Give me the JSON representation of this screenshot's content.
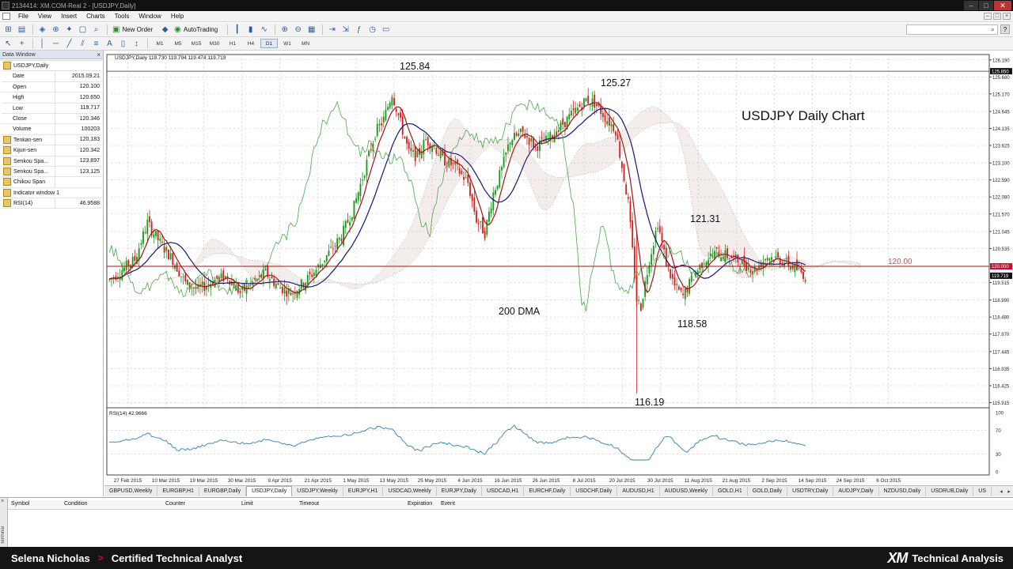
{
  "window": {
    "title": "2134414: XM.COM-Real 2 - [USDJPY,Daily]",
    "minimize": "–",
    "maximize": "□",
    "close": "✕"
  },
  "menu": [
    "File",
    "View",
    "Insert",
    "Charts",
    "Tools",
    "Window",
    "Help"
  ],
  "toolbar": {
    "new_order": "New Order",
    "autotrading": "AutoTrading",
    "timeframes": [
      "M1",
      "M5",
      "M15",
      "M30",
      "H1",
      "H4",
      "D1",
      "W1",
      "MN"
    ],
    "active_timeframe": "D1"
  },
  "data_window": {
    "title": "Data Window",
    "symbol": "USDJPY,Daily",
    "rows": [
      {
        "label": "Date",
        "value": "2015.09.21"
      },
      {
        "label": "Open",
        "value": "120.100"
      },
      {
        "label": "High",
        "value": "120.650"
      },
      {
        "label": "Low",
        "value": "119.717"
      },
      {
        "label": "Close",
        "value": "120.346"
      },
      {
        "label": "Volume",
        "value": "100203"
      }
    ],
    "indicators": [
      {
        "label": "Tenkan-sen",
        "value": "120.183"
      },
      {
        "label": "Kijun-sen",
        "value": "120.342"
      },
      {
        "label": "Senkou Spa...",
        "value": "123.897"
      },
      {
        "label": "Senkou Spa...",
        "value": "123.125"
      },
      {
        "label": "Chikou Span",
        "value": ""
      }
    ],
    "indicator_window": "Indicator window 1",
    "rsi": {
      "label": "RSI(14)",
      "value": "46.9588"
    }
  },
  "chart_data": {
    "type": "candlestick",
    "header": "USDJPY,Daily 119.730 119.794 119.474 119.719",
    "annotation_title": "USDJPY Daily Chart",
    "annotations": [
      "125.84",
      "125.27",
      "121.31",
      "118.58",
      "116.19",
      "200 DMA",
      "120.00"
    ],
    "y_ticks": [
      "126.190",
      "125.680",
      "125.170",
      "124.645",
      "124.135",
      "123.625",
      "123.100",
      "122.590",
      "122.080",
      "121.570",
      "121.045",
      "120.535",
      "119.515",
      "118.990",
      "118.480",
      "117.970",
      "117.445",
      "116.935",
      "116.425",
      "115.915"
    ],
    "price_tags": [
      "125.850",
      "120.000",
      "119.719"
    ],
    "x_ticks": [
      "27 Feb 2015",
      "10 Mar 2015",
      "19 Mar 2015",
      "30 Mar 2015",
      "9 Apr 2015",
      "21 Apr 2015",
      "1 May 2015",
      "13 May 2015",
      "25 May 2015",
      "4 Jun 2015",
      "16 Jun 2015",
      "26 Jun 2015",
      "8 Jul 2015",
      "20 Jul 2015",
      "30 Jul 2015",
      "11 Aug 2015",
      "21 Aug 2015",
      "2 Sep 2015",
      "14 Sep 2015",
      "24 Sep 2015",
      "6 Oct 2015"
    ],
    "ylim": [
      115.76,
      126.35
    ],
    "ohlc_key_points": [
      [
        0,
        119.6
      ],
      [
        6,
        119.9
      ],
      [
        12,
        120.2
      ],
      [
        18,
        121.3
      ],
      [
        24,
        120.7
      ],
      [
        30,
        120.2
      ],
      [
        36,
        119.5
      ],
      [
        42,
        119.3
      ],
      [
        50,
        119.6
      ],
      [
        56,
        119.7
      ],
      [
        62,
        119.2
      ],
      [
        68,
        119.5
      ],
      [
        74,
        119.8
      ],
      [
        80,
        119.4
      ],
      [
        86,
        119.2
      ],
      [
        92,
        119.5
      ],
      [
        98,
        119.9
      ],
      [
        104,
        120.4
      ],
      [
        110,
        120.9
      ],
      [
        116,
        121.8
      ],
      [
        122,
        123.1
      ],
      [
        126,
        124.0
      ],
      [
        130,
        124.4
      ],
      [
        134,
        125.2
      ],
      [
        138,
        124.3
      ],
      [
        142,
        123.4
      ],
      [
        146,
        123.3
      ],
      [
        150,
        123.8
      ],
      [
        154,
        123.6
      ],
      [
        158,
        123.2
      ],
      [
        164,
        123.0
      ],
      [
        170,
        122.5
      ],
      [
        174,
        121.4
      ],
      [
        178,
        121.0
      ],
      [
        182,
        122.2
      ],
      [
        186,
        122.9
      ],
      [
        190,
        123.8
      ],
      [
        196,
        124.0
      ],
      [
        202,
        123.6
      ],
      [
        208,
        123.8
      ],
      [
        214,
        124.2
      ],
      [
        220,
        124.6
      ],
      [
        226,
        125.0
      ],
      [
        230,
        124.9
      ],
      [
        236,
        124.4
      ],
      [
        240,
        124.1
      ],
      [
        246,
        121.9
      ],
      [
        250,
        119.0
      ],
      [
        252,
        118.8
      ],
      [
        256,
        120.2
      ],
      [
        260,
        121.3
      ],
      [
        264,
        120.1
      ],
      [
        268,
        119.4
      ],
      [
        272,
        119.1
      ],
      [
        276,
        119.6
      ],
      [
        282,
        120.2
      ],
      [
        288,
        120.4
      ],
      [
        294,
        120.3
      ],
      [
        300,
        120.1
      ],
      [
        306,
        119.9
      ],
      [
        312,
        120.3
      ],
      [
        318,
        120.2
      ],
      [
        324,
        120.0
      ],
      [
        330,
        119.72
      ]
    ],
    "indicator": {
      "label": "RSI(14) 42.9666",
      "levels": [
        100,
        70,
        30,
        0
      ]
    }
  },
  "symbol_tabs": [
    "GBPUSD,Weekly",
    "EURGBP,H1",
    "EURGBP,Daily",
    "USDJPY,Daily",
    "USDJPY,Weekly",
    "EURJPY,H1",
    "USDCAD,Weekly",
    "EURJPY,Daily",
    "USDCAD,H1",
    "EURCHF,Daily",
    "USDCHF,Daily",
    "AUDUSD,H1",
    "AUDUSD,Weekly",
    "GOLD,H1",
    "GOLD,Daily",
    "USDTRY,Daily",
    "AUDJPY,Daily",
    "NZDUSD,Daily",
    "USDRUB,Daily",
    "US"
  ],
  "active_tab": "USDJPY,Daily",
  "terminal": {
    "columns": [
      "Symbol",
      "Condition",
      "Counter",
      "Limit",
      "Timeout",
      "Expiration",
      "Event"
    ],
    "side_label": "Terminal"
  },
  "footer": {
    "name": "Selena Nicholas",
    "arrow": ">",
    "title": "Certified Technical Analyst",
    "logo": "XM",
    "subtitle": "Technical Analysis"
  },
  "colors": {
    "bull": "#1a9a1a",
    "bear": "#d62020",
    "tenkan": "#a01414",
    "kijun": "#14147a",
    "chikou": "#49a849",
    "rsi": "#2f7fb5",
    "cloud": "#9a7060"
  }
}
